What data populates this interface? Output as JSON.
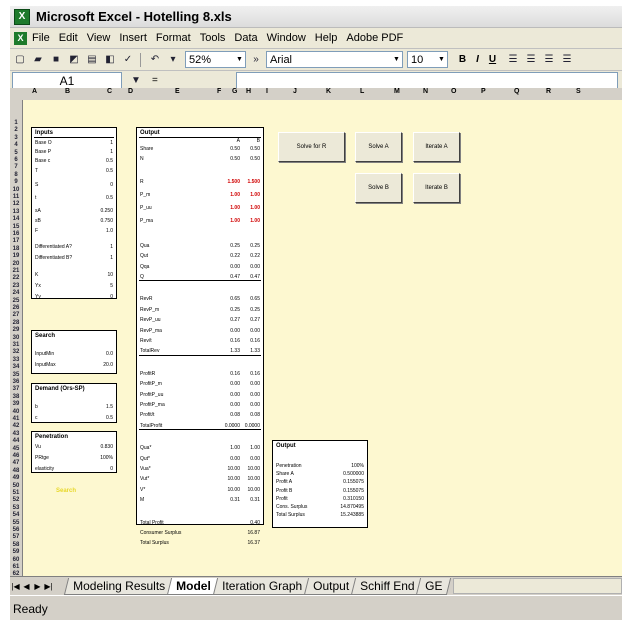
{
  "window": {
    "title": "Microsoft Excel - Hotelling 8.xls"
  },
  "menu": [
    "File",
    "Edit",
    "View",
    "Insert",
    "Format",
    "Tools",
    "Data",
    "Window",
    "Help",
    "Adobe PDF"
  ],
  "toolbar": {
    "zoom": "52%",
    "font": "Arial",
    "font_size": "10",
    "bold": "B",
    "italic": "I",
    "underline": "U"
  },
  "formula_bar": {
    "name_box": "A1",
    "fx": "="
  },
  "columns": [
    "A",
    "B",
    "C",
    "D",
    "E",
    "F",
    "G",
    "H",
    "I",
    "J",
    "K",
    "L",
    "M",
    "N",
    "O",
    "P",
    "Q",
    "R",
    "S"
  ],
  "inputs_panel": {
    "title": "Inputs",
    "rows": [
      {
        "label": "Base O",
        "value": "1"
      },
      {
        "label": "Base P",
        "value": "1"
      },
      {
        "label": "Base c",
        "value": "0.5"
      },
      {
        "label": "T",
        "value": "0.5"
      },
      {
        "label": "S",
        "value": "0"
      },
      {
        "label": "t",
        "value": "0.5"
      },
      {
        "label": "sA",
        "value": "0.250"
      },
      {
        "label": "sB",
        "value": "0.750"
      },
      {
        "label": "F",
        "value": "1.0"
      },
      {
        "label": "Differentiated A?",
        "value": "1"
      },
      {
        "label": "Differentiated B?",
        "value": "1"
      },
      {
        "label": "K",
        "value": "10"
      },
      {
        "label": "Yx",
        "value": "5"
      },
      {
        "label": "Yy",
        "value": "0"
      }
    ]
  },
  "search_panel": {
    "title": "Search",
    "rows": [
      {
        "label": "InputMin",
        "value": "0.0"
      },
      {
        "label": "InputMax",
        "value": "20.0"
      }
    ]
  },
  "demand_panel": {
    "title": "Demand (Ors-SP)",
    "rows": [
      {
        "label": "b",
        "value": "1.5"
      },
      {
        "label": "c",
        "value": "0.5"
      }
    ]
  },
  "penetration_panel": {
    "title": "Penetration",
    "rows": [
      {
        "label": "Vu",
        "value": "0.830"
      },
      {
        "label": "PRtge",
        "value": "100%"
      },
      {
        "label": "elasticity",
        "value": "0"
      }
    ]
  },
  "output_panel": {
    "title": "Output",
    "col_headers": [
      "A",
      "B"
    ],
    "groups": [
      [
        {
          "label": "Share",
          "a": "0.50",
          "b": "0.50"
        },
        {
          "label": "N",
          "a": "0.50",
          "b": "0.50"
        }
      ],
      [
        {
          "label": "R",
          "a": "1.500",
          "b": "1.500",
          "red": true
        },
        {
          "label": "P_m",
          "a": "1.00",
          "b": "1.00",
          "red": true
        },
        {
          "label": "P_uu",
          "a": "1.00",
          "b": "1.00",
          "red": true
        },
        {
          "label": "P_ma",
          "a": "1.00",
          "b": "1.00",
          "red": true
        }
      ],
      [
        {
          "label": "Qua",
          "a": "0.25",
          "b": "0.25"
        },
        {
          "label": "Qut",
          "a": "0.22",
          "b": "0.22"
        },
        {
          "label": "Qqa",
          "a": "0.00",
          "b": "0.00"
        },
        {
          "label": "Q",
          "a": "0.47",
          "b": "0.47"
        }
      ],
      [
        {
          "label": "RevR",
          "a": "0.65",
          "b": "0.65"
        },
        {
          "label": "RevP_m",
          "a": "0.25",
          "b": "0.25"
        },
        {
          "label": "RevP_uu",
          "a": "0.27",
          "b": "0.27"
        },
        {
          "label": "RevP_ma",
          "a": "0.00",
          "b": "0.00"
        },
        {
          "label": "Rev/t",
          "a": "0.16",
          "b": "0.16"
        },
        {
          "label": "TotalRev",
          "a": "1.33",
          "b": "1.33"
        }
      ],
      [
        {
          "label": "ProfitR",
          "a": "0.16",
          "b": "0.16"
        },
        {
          "label": "ProfitP_m",
          "a": "0.00",
          "b": "0.00"
        },
        {
          "label": "ProfitP_uu",
          "a": "0.00",
          "b": "0.00"
        },
        {
          "label": "ProfitP_ma",
          "a": "0.00",
          "b": "0.00"
        },
        {
          "label": "Profit/t",
          "a": "0.08",
          "b": "0.08"
        },
        {
          "label": "TotalProfit",
          "a": "0.0000",
          "b": "0.0000"
        }
      ],
      [
        {
          "label": "Qua*",
          "a": "1.00",
          "b": "1.00"
        },
        {
          "label": "Qut*",
          "a": "0.00",
          "b": "0.00"
        },
        {
          "label": "Vua*",
          "a": "10.00",
          "b": "10.00"
        },
        {
          "label": "Vut*",
          "a": "10.00",
          "b": "10.00"
        },
        {
          "label": "V*",
          "a": "10.00",
          "b": "10.00"
        },
        {
          "label": "M",
          "a": "0.31",
          "b": "0.31"
        }
      ],
      [
        {
          "label": "Total Profit",
          "a": "",
          "b": "0.40"
        },
        {
          "label": "Consumer Surplus",
          "a": "",
          "b": "16.87"
        },
        {
          "label": "Total Surplus",
          "a": "",
          "b": "16.37"
        }
      ]
    ]
  },
  "output2_panel": {
    "title": "Output",
    "rows": [
      {
        "label": "Penetration",
        "value": "100%"
      },
      {
        "label": "Share A",
        "value": "0.500000"
      },
      {
        "label": "Profit A",
        "value": "0.155075"
      },
      {
        "label": "Profit B",
        "value": "0.155075"
      },
      {
        "label": "Profit",
        "value": "0.310150"
      },
      {
        "label": "Cons. Surplus",
        "value": "14.870495"
      },
      {
        "label": "Total Surplus",
        "value": "15.243885"
      }
    ]
  },
  "buttons": {
    "solve_r": "Solve for R",
    "solve_a": "Solve A",
    "iterate_a": "Iterate A",
    "solve_b": "Solve B",
    "iterate_b": "Iterate B"
  },
  "yellow_note": "Search",
  "sheet_tabs": [
    "Modeling Results",
    "Model",
    "Iteration Graph",
    "Output",
    "Schiff End",
    "GE"
  ],
  "active_tab": "Model",
  "status": "Ready"
}
